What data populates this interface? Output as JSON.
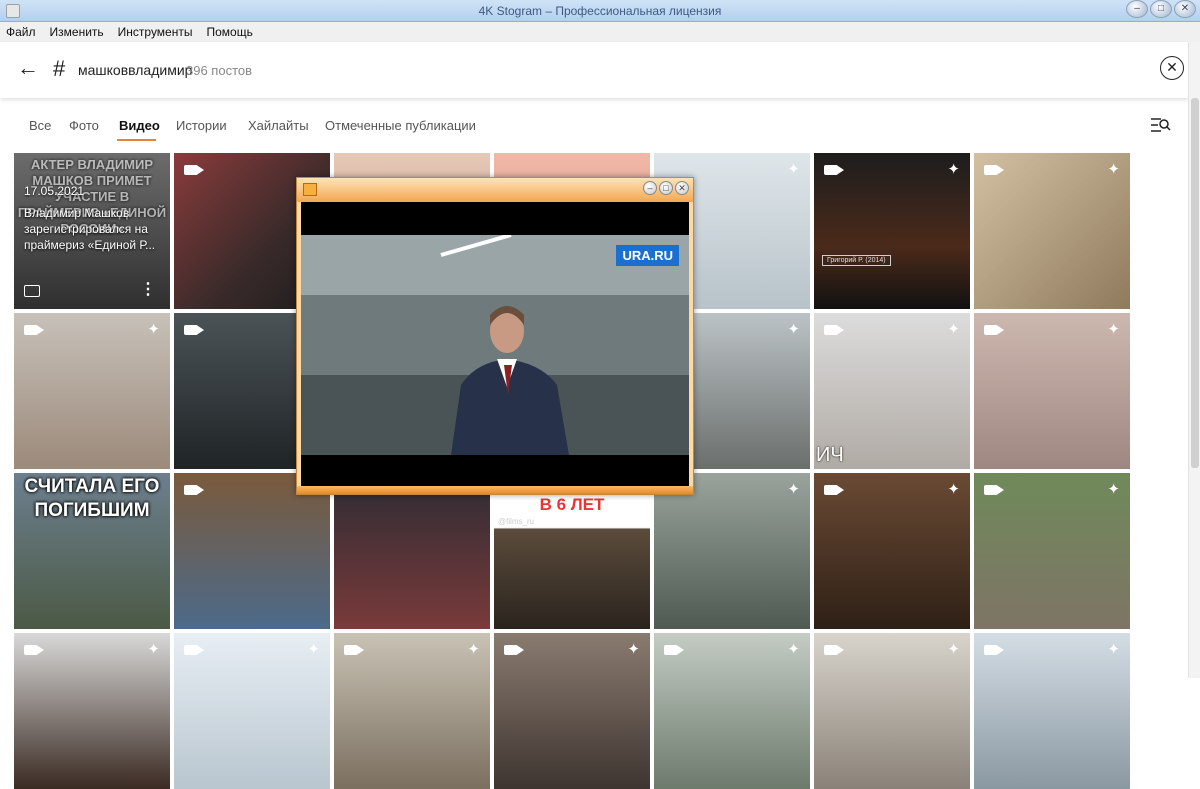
{
  "window": {
    "title": "4K Stogram – Профессиональная лицензия"
  },
  "menu": [
    "Файл",
    "Изменить",
    "Инструменты",
    "Помощь"
  ],
  "header": {
    "hashtag": "машковвладимир",
    "post_count": "396 постов"
  },
  "tabs": [
    {
      "label": "Все",
      "active": false
    },
    {
      "label": "Фото",
      "active": false
    },
    {
      "label": "Видео",
      "active": true
    },
    {
      "label": "Истории",
      "active": false
    },
    {
      "label": "Хайлайты",
      "active": false
    },
    {
      "label": "Отмеченные публикации",
      "active": false
    }
  ],
  "first_tile": {
    "overlay_text": "АКТЕР ВЛАДИМИР МАШКОВ ПРИМЕТ УЧАСТИЕ В ПРАЙМЕРИЗ «ЕДИНОЙ РОССИИ»",
    "date": "17.05.2021",
    "description": "Владимир Машков зарегистрировался на праймериз «Единой Р..."
  },
  "tile_texts": {
    "tile_row3_col1": "СЧИТАЛА ЕГО ПОГИБШИМ",
    "tile_row3_col4": "БЕЗ РОДИТЕЛЕЙ В 6 ЛЕТ",
    "tile_row3_col4_handle": "@films_ru",
    "tile_row2_col5": "ИЧ",
    "tile_row1_col6_caption": "Григорий Р. (2014)"
  },
  "player": {
    "watermark": "URA.RU"
  },
  "colors": {
    "accent": "#e3843a",
    "titlebar": "#b4cfee"
  }
}
